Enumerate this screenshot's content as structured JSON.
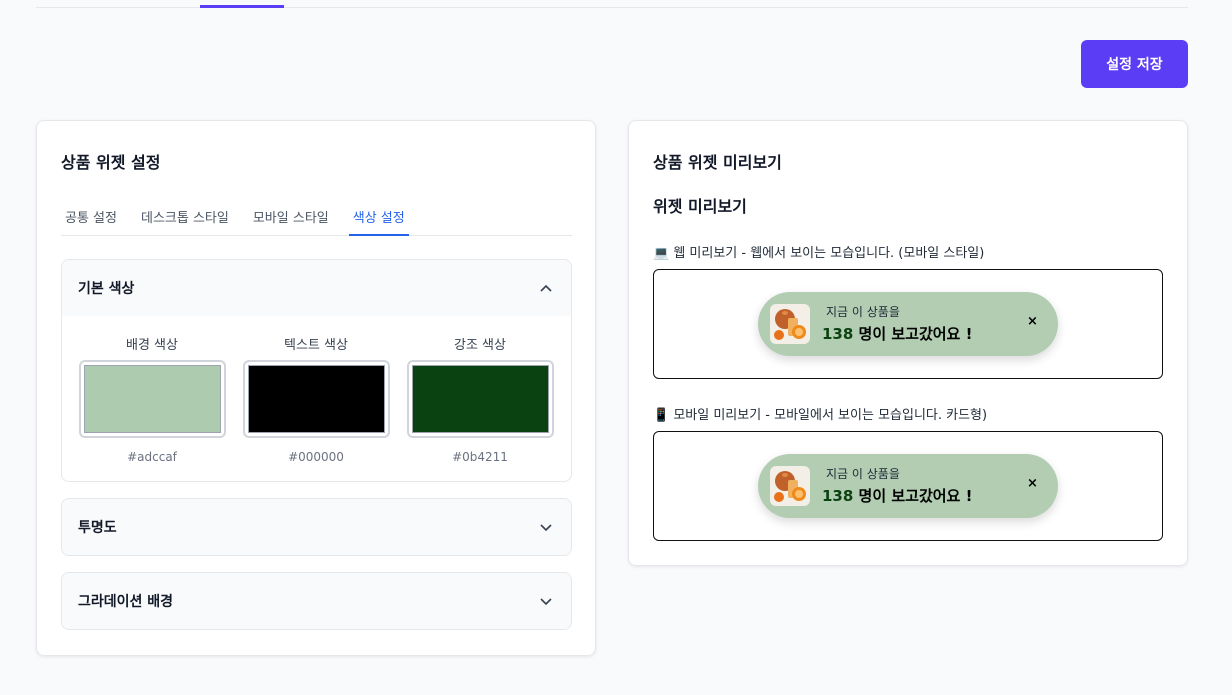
{
  "header": {
    "save_label": "설정 저장"
  },
  "settings": {
    "title": "상품 위젯 설정",
    "tabs": [
      {
        "label": "공통 설정",
        "active": false
      },
      {
        "label": "데스크톱 스타일",
        "active": false
      },
      {
        "label": "모바일 스타일",
        "active": false
      },
      {
        "label": "색상 설정",
        "active": true
      }
    ],
    "basic_colors": {
      "title": "기본 색상",
      "expanded": true,
      "swatches": [
        {
          "label": "배경 색상",
          "hex": "#adccaf"
        },
        {
          "label": "텍스트 색상",
          "hex": "#000000"
        },
        {
          "label": "강조 색상",
          "hex": "#0b4211"
        }
      ]
    },
    "opacity": {
      "title": "투명도",
      "expanded": false
    },
    "gradient": {
      "title": "그라데이션 배경",
      "expanded": false
    }
  },
  "preview": {
    "title": "상품 위젯 미리보기",
    "subtitle": "위젯 미리보기",
    "web_label": "💻 웹 미리보기 - 웹에서 보이는 모습입니다. (모바일 스타일)",
    "mobile_label": "📱 모바일 미리보기 - 모바일에서 보이는 모습입니다. 카드형)",
    "widget": {
      "top_text": "지금 이 상품을",
      "count": "138",
      "suffix": " 명이 보고갔어요 !",
      "close": "×"
    }
  },
  "colors": {
    "accent": "#5b3df5",
    "tab_active": "#2563eb",
    "widget_bg": "#b2cdb2",
    "widget_highlight": "#0b4211"
  }
}
